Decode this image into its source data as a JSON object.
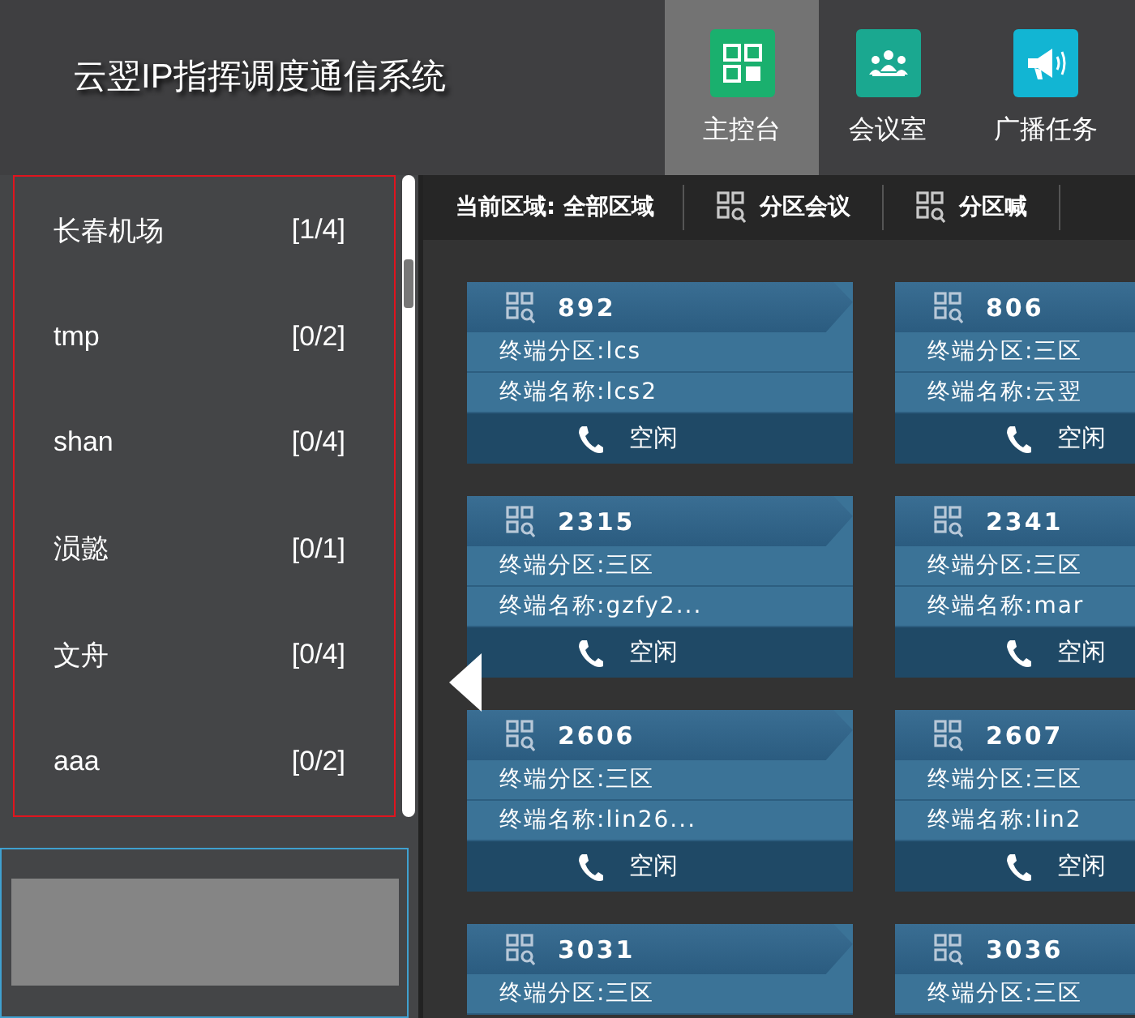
{
  "header": {
    "title": "云翌IP指挥调度通信系统"
  },
  "nav": [
    {
      "label": "主控台",
      "kind": "console",
      "selected": true
    },
    {
      "label": "会议室",
      "kind": "meeting",
      "selected": false
    },
    {
      "label": "广播任务",
      "kind": "broadcast",
      "selected": false
    }
  ],
  "sidebar": {
    "items": [
      {
        "name": "长春机场",
        "count": "[1/4]"
      },
      {
        "name": "tmp",
        "count": "[0/2]"
      },
      {
        "name": "shan",
        "count": "[0/4]"
      },
      {
        "name": "涢懿",
        "count": "[0/1]"
      },
      {
        "name": "文舟",
        "count": "[0/4]"
      },
      {
        "name": "aaa",
        "count": "[0/2]"
      }
    ]
  },
  "toolbar": {
    "region": "当前区域: 全部区域",
    "actions": [
      "分区会议",
      "分区喊"
    ]
  },
  "terminals": [
    {
      "number": "892",
      "partition": "终端分区:lcs",
      "name": "终端名称:lcs2",
      "status": "空闲"
    },
    {
      "number": "806",
      "partition": "终端分区:三区",
      "name": "终端名称:云翌",
      "status": "空闲"
    },
    {
      "number": "2315",
      "partition": "终端分区:三区",
      "name": "终端名称:gzfy2...",
      "status": "空闲"
    },
    {
      "number": "2341",
      "partition": "终端分区:三区",
      "name": "终端名称:mar",
      "status": "空闲"
    },
    {
      "number": "2606",
      "partition": "终端分区:三区",
      "name": "终端名称:lin26...",
      "status": "空闲"
    },
    {
      "number": "2607",
      "partition": "终端分区:三区",
      "name": "终端名称:lin2",
      "status": "空闲"
    },
    {
      "number": "3031",
      "partition": "终端分区:三区"
    },
    {
      "number": "3036",
      "partition": "终端分区:三区"
    }
  ]
}
